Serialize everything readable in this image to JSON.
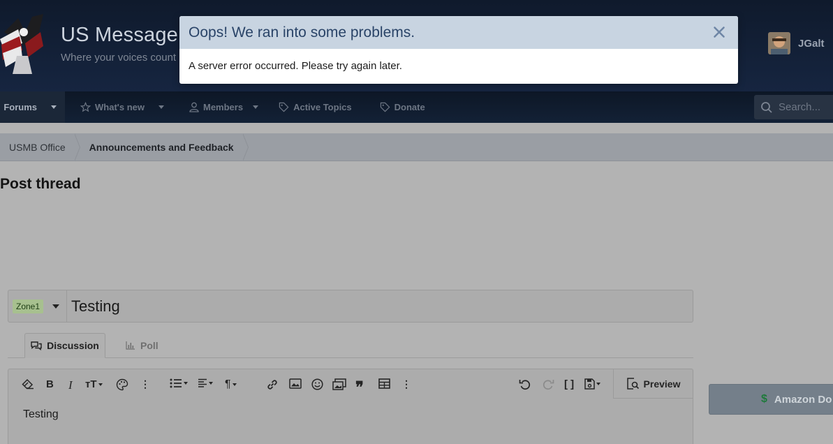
{
  "header": {
    "site_title": "US Message",
    "tagline": "Where your voices count",
    "username": "JGalt"
  },
  "nav": {
    "items": [
      {
        "label": "Forums",
        "icon": "forums-icon",
        "has_caret": true,
        "active": true
      },
      {
        "label": "What's new",
        "icon": "star-icon",
        "has_caret": true
      },
      {
        "label": "Members",
        "icon": "user-icon",
        "has_caret": true
      },
      {
        "label": "Active Topics",
        "icon": "tag-icon"
      },
      {
        "label": "Donate",
        "icon": "tag-icon"
      }
    ],
    "search_placeholder": "Search..."
  },
  "breadcrumb": [
    "USMB Office",
    "Announcements and Feedback"
  ],
  "page_title": "Post thread",
  "thread": {
    "prefix": "Zone1",
    "title": "Testing"
  },
  "tabs": {
    "discussion": "Discussion",
    "poll": "Poll"
  },
  "editor": {
    "body": "Testing",
    "preview_label": "Preview"
  },
  "side_button": {
    "label": "Amazon Do"
  },
  "modal": {
    "title": "Oops! We ran into some problems.",
    "message": "A server error occurred. Please try again later."
  },
  "colors": {
    "header_bg": "#0f1a2c",
    "modal_header_bg": "#c8d4e1",
    "modal_title": "#2a4468",
    "prefix_tag": "#a7c08f"
  }
}
